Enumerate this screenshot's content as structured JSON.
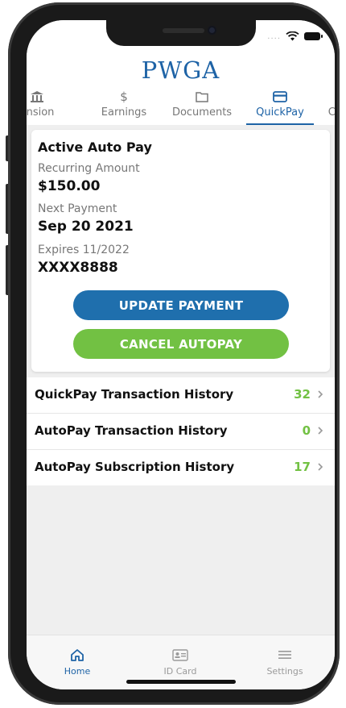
{
  "header": {
    "brand": "PWGA"
  },
  "tabs": [
    {
      "label": "ension",
      "icon": "bank-icon"
    },
    {
      "label": "Earnings",
      "icon": "dollar-icon"
    },
    {
      "label": "Documents",
      "icon": "folder-icon"
    },
    {
      "label": "QuickPay",
      "icon": "card-icon",
      "active": true
    },
    {
      "label": "Contact",
      "icon": "chat-icon"
    }
  ],
  "card": {
    "title": "Active Auto Pay",
    "recurring_label": "Recurring Amount",
    "recurring_value": "$150.00",
    "next_label": "Next Payment",
    "next_value": "Sep 20 2021",
    "expires_label": "Expires 11/2022",
    "card_number": "XXXX8888",
    "update_button": "UPDATE PAYMENT",
    "cancel_button": "CANCEL AUTOPAY"
  },
  "history": [
    {
      "label": "QuickPay Transaction History",
      "count": "32"
    },
    {
      "label": "AutoPay Transaction History",
      "count": "0"
    },
    {
      "label": "AutoPay Subscription History",
      "count": "17"
    }
  ],
  "bottom_nav": [
    {
      "label": "Home",
      "icon": "home-icon",
      "active": true
    },
    {
      "label": "ID Card",
      "icon": "id-card-icon"
    },
    {
      "label": "Settings",
      "icon": "menu-icon"
    }
  ],
  "colors": {
    "primary": "#1e63a6",
    "accent_green": "#72c143",
    "update_button": "#1f6fad"
  }
}
